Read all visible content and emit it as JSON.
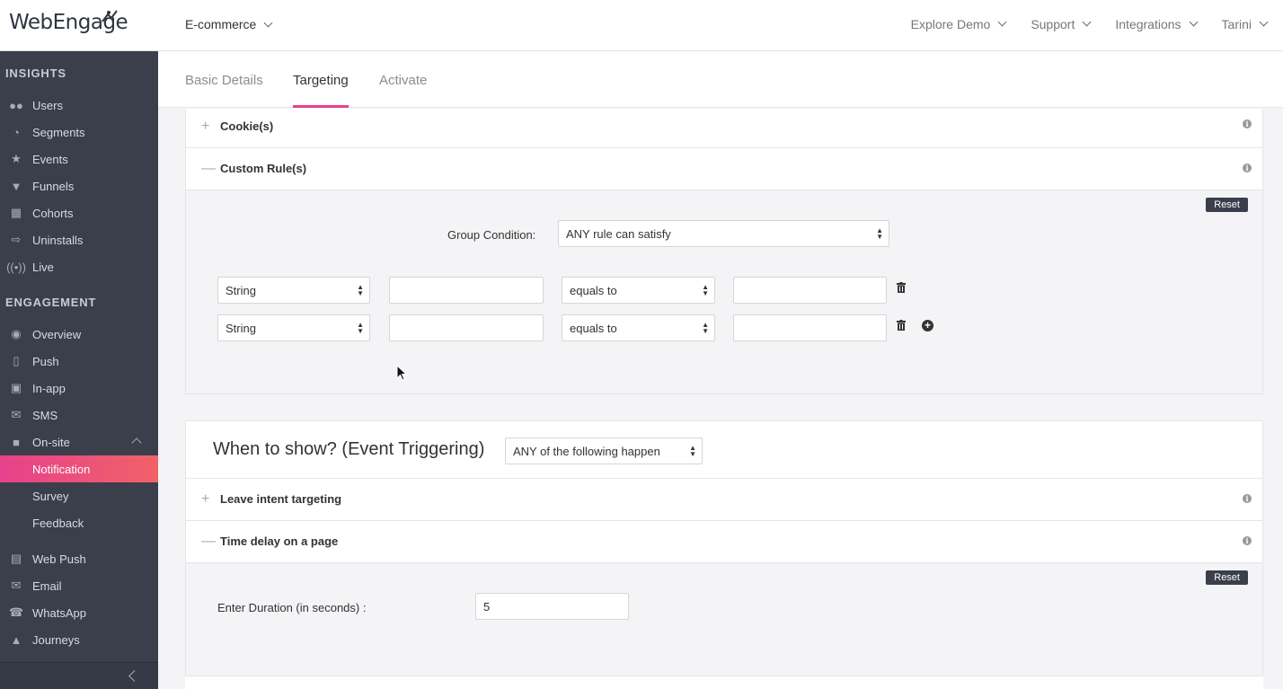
{
  "header": {
    "logo_text": "WebEngage",
    "project": "E-commerce",
    "nav": [
      "Explore Demo",
      "Support",
      "Integrations",
      "Tarini"
    ]
  },
  "sidebar": {
    "sections": [
      {
        "label": "INSIGHTS"
      },
      {
        "label": "ENGAGEMENT"
      }
    ],
    "insights": [
      {
        "label": "Users",
        "icon": "users-icon"
      },
      {
        "label": "Segments",
        "icon": "pie-icon"
      },
      {
        "label": "Events",
        "icon": "star-icon"
      },
      {
        "label": "Funnels",
        "icon": "funnel-icon"
      },
      {
        "label": "Cohorts",
        "icon": "grid-icon"
      },
      {
        "label": "Uninstalls",
        "icon": "uninstall-icon"
      },
      {
        "label": "Live",
        "icon": "live-icon"
      }
    ],
    "engagement": [
      {
        "label": "Overview",
        "icon": "eye-icon"
      },
      {
        "label": "Push",
        "icon": "phone-icon"
      },
      {
        "label": "In-app",
        "icon": "inapp-icon"
      },
      {
        "label": "SMS",
        "icon": "sms-icon"
      },
      {
        "label": "On-site",
        "icon": "onsite-icon"
      },
      {
        "label": "Notification"
      },
      {
        "label": "Survey"
      },
      {
        "label": "Feedback"
      },
      {
        "label": "Web Push",
        "icon": "webpush-icon"
      },
      {
        "label": "Email",
        "icon": "email-icon"
      },
      {
        "label": "WhatsApp",
        "icon": "whatsapp-icon"
      },
      {
        "label": "Journeys",
        "icon": "journey-icon"
      }
    ]
  },
  "tabs": [
    "Basic Details",
    "Targeting",
    "Activate"
  ],
  "rules": {
    "cookies": "Cookie(s)",
    "custom_rules": "Custom Rule(s)",
    "reset": "Reset",
    "group_condition_label": "Group Condition:",
    "group_condition_value": "ANY rule can satisfy",
    "rows": [
      {
        "type": "String",
        "key": "",
        "operator": "equals to",
        "value": ""
      },
      {
        "type": "String",
        "key": "",
        "operator": "equals to",
        "value": ""
      }
    ]
  },
  "when": {
    "heading": "When to show? (Event Triggering)",
    "condition": "ANY of the following happen",
    "leave_intent": "Leave intent targeting",
    "time_delay": "Time delay on a page",
    "reset": "Reset",
    "duration_label": "Enter Duration (in seconds) :",
    "duration_value": "5"
  },
  "colors": {
    "accent": "#e7418b",
    "sidebar": "#3b3e4b"
  }
}
